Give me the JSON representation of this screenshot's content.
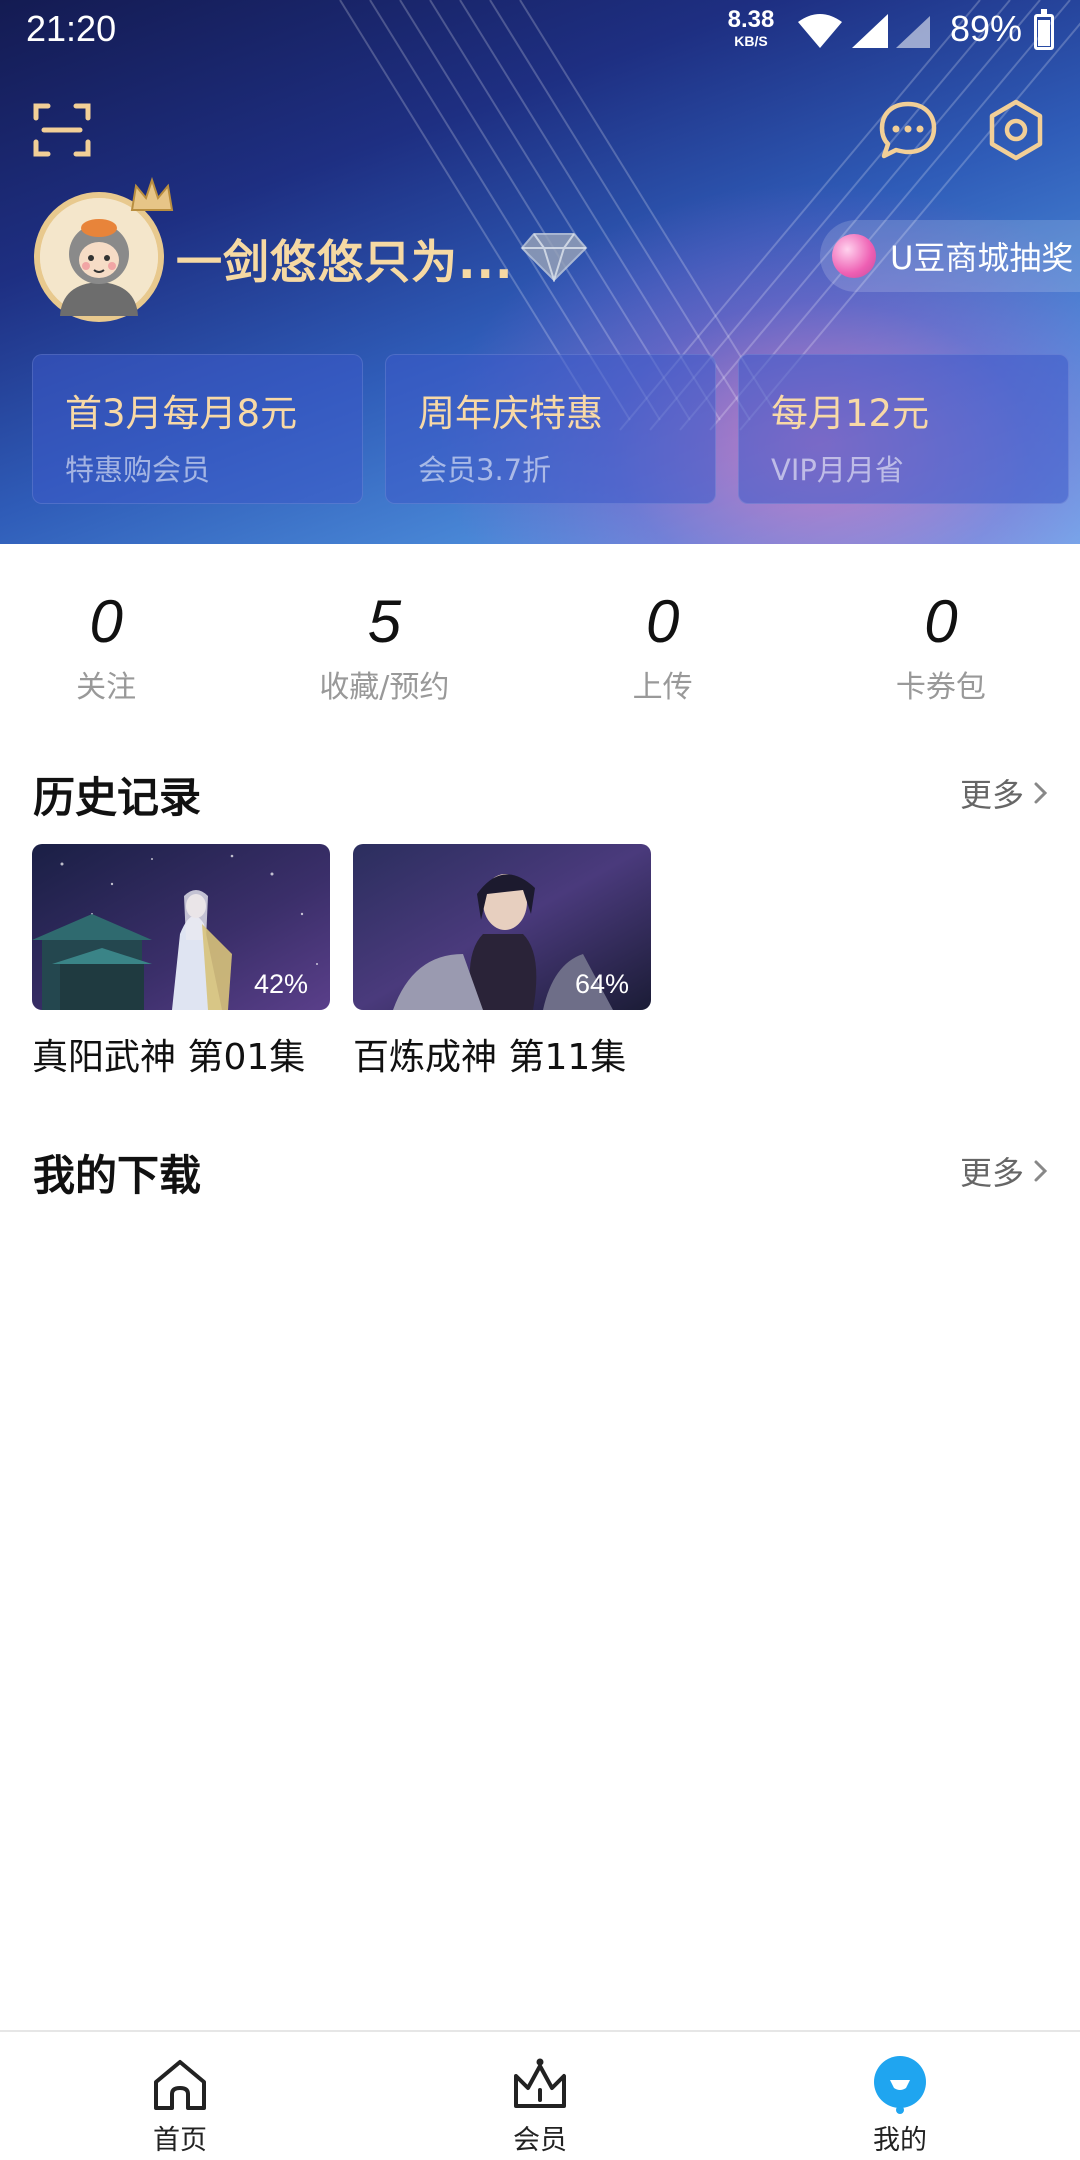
{
  "status_bar": {
    "time": "21:20",
    "net_speed_value": "8.38",
    "net_speed_unit": "KB/S",
    "battery_percent": "89%"
  },
  "header": {
    "username": "一剑悠悠只为...",
    "lottery_label": "U豆商城抽奖",
    "promos": [
      {
        "title": "首3月每月8元",
        "subtitle": "特惠购会员"
      },
      {
        "title": "周年庆特惠",
        "subtitle": "会员3.7折"
      },
      {
        "title": "每月12元",
        "subtitle": "VIP月月省"
      }
    ]
  },
  "stats": [
    {
      "value": "0",
      "label": "关注"
    },
    {
      "value": "5",
      "label": "收藏/预约"
    },
    {
      "value": "0",
      "label": "上传"
    },
    {
      "value": "0",
      "label": "卡券包"
    }
  ],
  "history": {
    "title": "历史记录",
    "more": "更多",
    "items": [
      {
        "title": "真阳武神 第01集",
        "progress": "42%"
      },
      {
        "title": "百炼成神 第11集",
        "progress": "64%"
      }
    ]
  },
  "downloads": {
    "title": "我的下载",
    "more": "更多"
  },
  "bottom_nav": [
    {
      "label": "首页",
      "icon": "home-icon"
    },
    {
      "label": "会员",
      "icon": "crown-icon"
    },
    {
      "label": "我的",
      "icon": "profile-icon",
      "active": true
    }
  ],
  "colors": {
    "accent_gold": "#f6d9a3",
    "active_blue": "#1fa5f0"
  }
}
